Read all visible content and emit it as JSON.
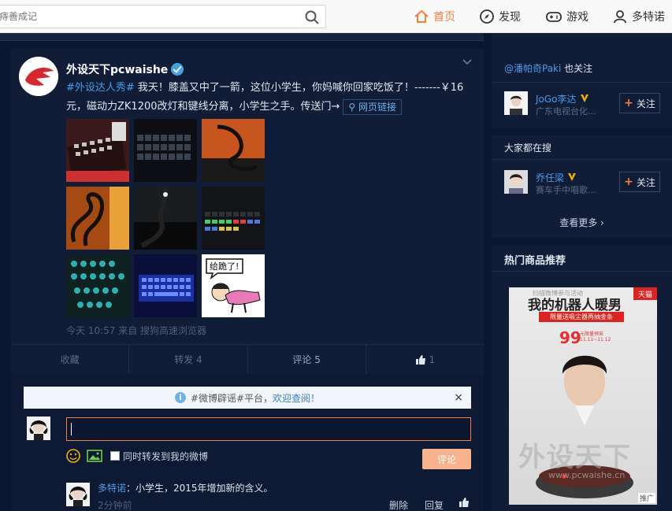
{
  "search": {
    "placeholder": "痔善成记"
  },
  "nav": {
    "home": "首页",
    "discover": "发现",
    "games": "游戏",
    "user": "多特诺"
  },
  "post": {
    "author": "外设天下pcwaishe",
    "tag": "#外设达人秀#",
    "text": " 我天！膝盖又中了一箭，这位小学生，你妈喊你回家吃饭了！-------￥16元，磁动力ZK1200改灯和键线分离，小学生之手。传送门→",
    "link_label": "网页链接",
    "meta": "今天 10:57 来自 搜狗高速浏览器",
    "thumb7_text": "给跪了!"
  },
  "actions": {
    "favorite": "收藏",
    "repost": "转发 4",
    "comment": "评论 5",
    "like": "1"
  },
  "comment_box": {
    "notice_pre": "#微博辟谣#平台，",
    "notice_link": "欢迎查阅！",
    "notice_close": "×",
    "input_value": "",
    "also_repost": "同时转发到我的微博",
    "submit": "评论"
  },
  "reply": {
    "name": "多特诺",
    "text": "：小学生，2015年增加新的含义。",
    "time": "2分钟前",
    "delete": "删除",
    "reply": "回复"
  },
  "sidebar": {
    "also_follow_name": "@潘帕奇Paki",
    "also_follow_suffix": " 也关注",
    "person1": {
      "name": "JoGo李达",
      "desc": "广东电视台化...",
      "follow": "关注"
    },
    "everyone_searching": "大家都在搜",
    "person2": {
      "name": "乔任梁",
      "desc": "赛车手中唱歌...",
      "follow": "关注"
    },
    "see_more": "查看更多 ›",
    "hot_goods": "热门商品推荐",
    "ad": {
      "small": "扫描微博参与活动",
      "headline": "我的机器人暖男",
      "badge": "天猫",
      "promo": "限量送吸尘器再抽金条",
      "price": "99",
      "price_note": "元限量预采\n11.11~11.12",
      "watermark": "外设天下",
      "url": "www.pcwaishe.cn",
      "ad_tag": "推广"
    }
  },
  "colors": {
    "accent": "#fa7d3c",
    "link": "#4a9be8",
    "background": "#0b1730",
    "card": "#111d37"
  }
}
